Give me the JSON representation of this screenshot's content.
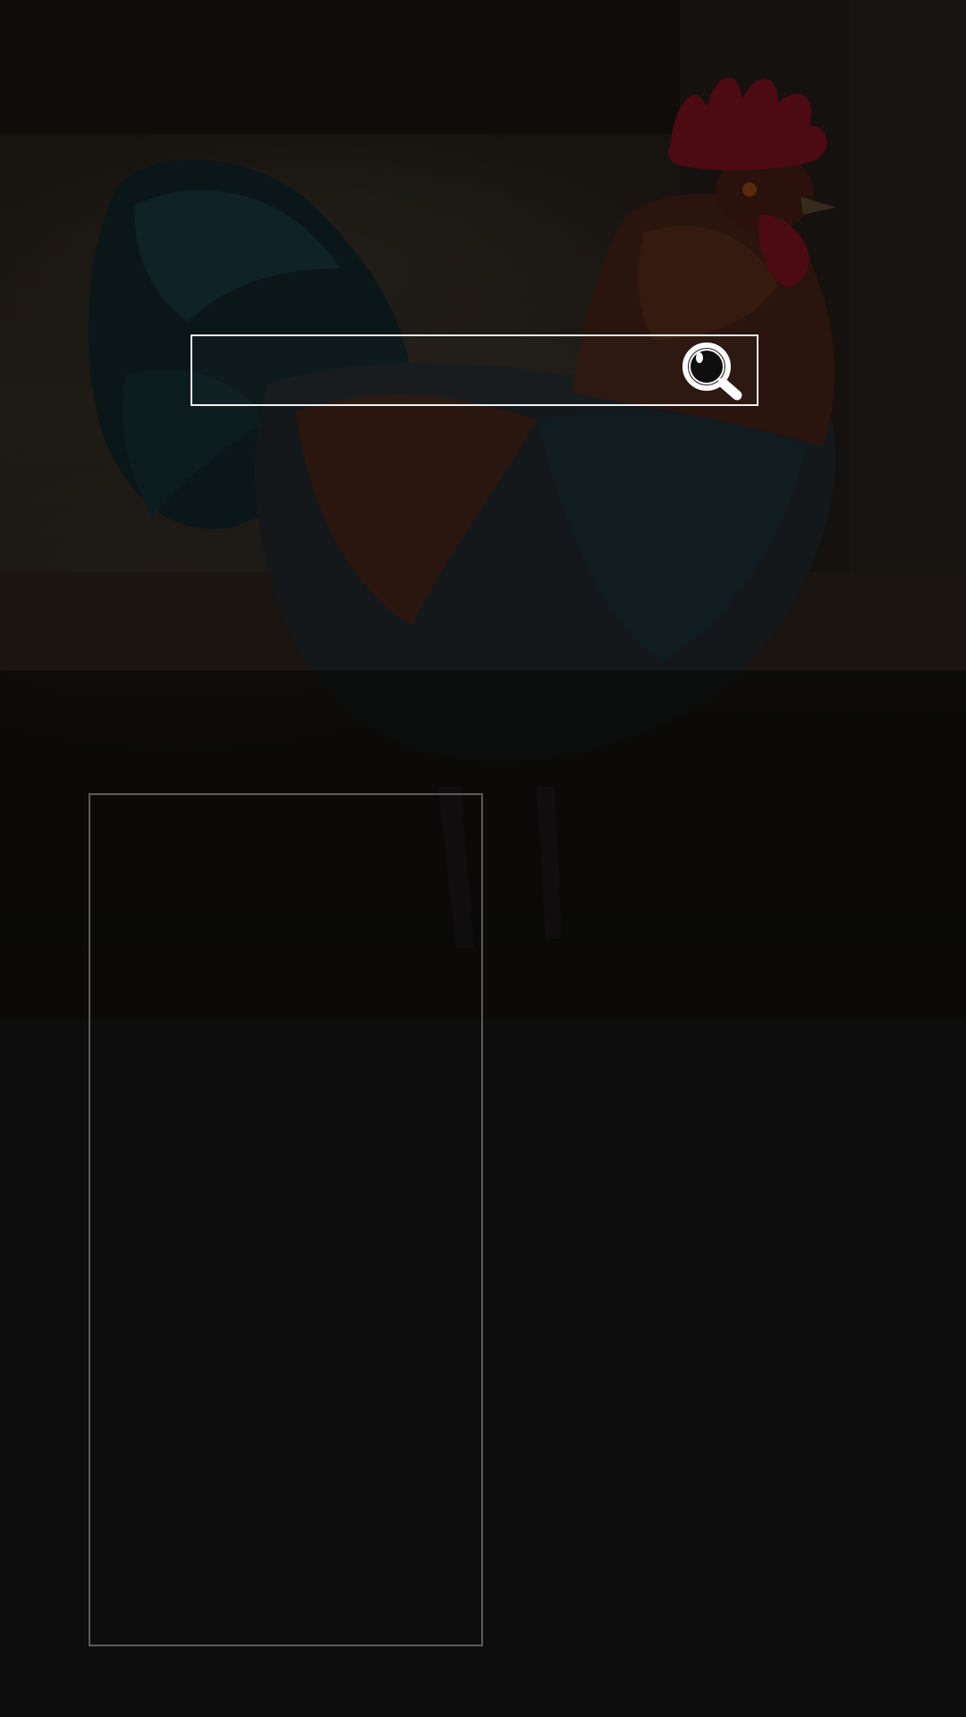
{
  "hero": {
    "image": "rooster-photo",
    "overlay_color": "#0d0d0d"
  },
  "search": {
    "placeholder": "",
    "value": "",
    "icon": "magnifier-icon"
  },
  "panel": {
    "border_color": "#5a5a5a"
  }
}
